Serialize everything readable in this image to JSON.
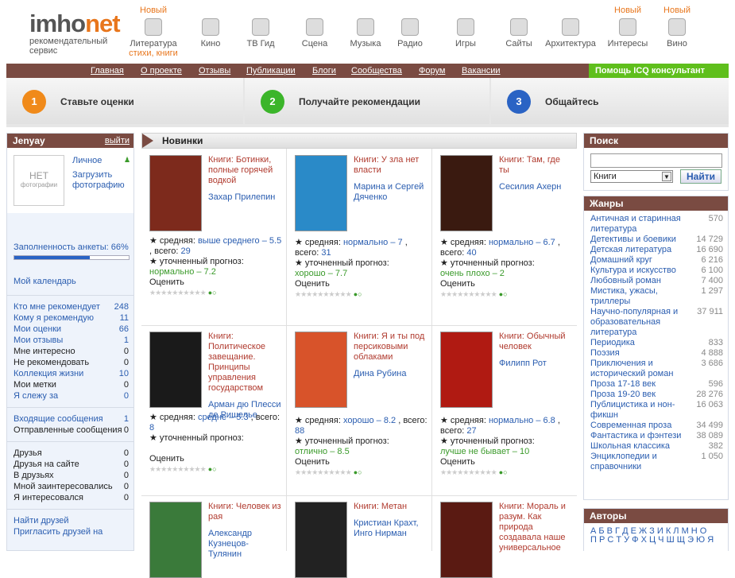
{
  "logo": {
    "im": "imho",
    "net": "net",
    "sub1": "рекомендательный",
    "sub2": "сервис"
  },
  "cats": [
    {
      "new": "Новый",
      "label": "Литература",
      "sub": "стихи, книги",
      "icon": "book-icon"
    },
    {
      "new": "",
      "label": "Кино",
      "sub": "",
      "icon": "film-reel-icon"
    },
    {
      "new": "",
      "label": "ТВ Гид",
      "sub": "",
      "icon": "tv-icon"
    },
    {
      "new": "",
      "label": "Сцена",
      "sub": "",
      "icon": "theater-mask-icon"
    },
    {
      "new": "",
      "label": "Музыка",
      "sub": "",
      "icon": "headphones-icon"
    },
    {
      "new": "",
      "label": "Радио",
      "sub": "",
      "icon": "radio-icon"
    },
    {
      "new": "",
      "label": "Игры",
      "sub": "",
      "icon": "gamepad-icon"
    },
    {
      "new": "",
      "label": "Сайты",
      "sub": "",
      "icon": "globe-icon"
    },
    {
      "new": "",
      "label": "Архитектура",
      "sub": "",
      "icon": "building-icon"
    },
    {
      "new": "Новый",
      "label": "Интересы",
      "sub": "",
      "icon": "helicopter-icon"
    },
    {
      "new": "Новый",
      "label": "Вино",
      "sub": "",
      "icon": "wine-glass-icon"
    }
  ],
  "nav": [
    "Главная",
    "О проекте",
    "Отзывы",
    "Публикации",
    "Блоги",
    "Сообщества",
    "Форум",
    "Вакансии"
  ],
  "nav_right": "Помощь   ICQ консультант",
  "steps": [
    {
      "n": "1",
      "text": "Ставьте оценки",
      "color": "#f08a1a"
    },
    {
      "n": "2",
      "text": "Получайте рекомендации",
      "color": "#3bb52a"
    },
    {
      "n": "3",
      "text": "Общайтесь",
      "color": "#2a63c4"
    }
  ],
  "user": {
    "name": "Jenyay",
    "logout": "выйти",
    "nophoto1": "НЕТ",
    "nophoto2": "фотографии",
    "personal": "Личное",
    "upload": "Загрузить фотографию",
    "fill": "Заполненность анкеты: 66%",
    "fill_pct": 0.66,
    "calendar": "Мой календарь"
  },
  "stats1": [
    [
      "Кто мне рекомендует",
      "248",
      1
    ],
    [
      "Кому я рекомендую",
      "11",
      1
    ],
    [
      "Мои оценки",
      "66",
      1
    ],
    [
      "Мои отзывы",
      "1",
      1
    ],
    [
      "Мне интересно",
      "0",
      0
    ],
    [
      "Не рекомендовать",
      "0",
      0
    ],
    [
      "Коллекция жизни",
      "10",
      1
    ],
    [
      "Мои метки",
      "0",
      0
    ],
    [
      "Я слежу за",
      "0",
      1
    ]
  ],
  "stats2": [
    [
      "Входящие сообщения",
      "1",
      1
    ],
    [
      "Отправленные сообщения",
      "0",
      0
    ]
  ],
  "stats3": [
    [
      "Друзья",
      "0",
      0
    ],
    [
      "Друзья на сайте",
      "0",
      0
    ],
    [
      "В друзьях",
      "0",
      0
    ],
    [
      "Мной заинтересовались",
      "0",
      0
    ],
    [
      "Я интересовался",
      "0",
      0
    ]
  ],
  "find": [
    "Найти друзей",
    "Пригласить друзей на"
  ],
  "center_title": "Новинки",
  "books": [
    {
      "title": "Книги: Ботинки, полные горячей водкой",
      "author": "Захар Прилепин",
      "l1": "★ средняя:",
      "l1v": "выше среднего – 5.5",
      "l1t": ", всего:",
      "cnt": "29",
      "l2": "★ уточненный прогноз:",
      "l2v": "нормально – 7.2",
      "rate": "Оценить",
      "cover": "#7d2a1c"
    },
    {
      "title": "Книги: У зла нет власти",
      "author": "Марина и Сергей Дяченко",
      "l1": "★ средняя:",
      "l1v": "нормально – 7",
      "l1t": ", всего:",
      "cnt": "31",
      "l2": "★ уточненный прогноз:",
      "l2v": "хорошо – 7.7",
      "rate": "Оценить",
      "cover": "#2a8ac8"
    },
    {
      "title": "Книги: Там, где ты",
      "author": "Сесилия Ахерн",
      "l1": "★ средняя:",
      "l1v": "нормально – 6.7",
      "l1t": ", всего:",
      "cnt": "40",
      "l2": "★ уточненный прогноз:",
      "l2v": "очень плохо – 2",
      "rate": "Оценить",
      "cover": "#3a1a10"
    },
    {
      "title": "Книги: Политическое завещание. Принципы управления государством",
      "author": "Арман дю Плесси де Ришелье",
      "l1": "★ средняя:",
      "l1v": "средне – 5.3",
      "l1t": ", всего:",
      "cnt": "8",
      "l2": "★ уточненный прогноз:",
      "l2v": "",
      "rate": "Оценить",
      "cover": "#1a1a1a"
    },
    {
      "title": "Книги: Я и ты под персиковыми облаками",
      "author": "Дина Рубина",
      "l1": "★ средняя:",
      "l1v": "хорошо – 8.2",
      "l1t": ", всего:",
      "cnt": "88",
      "l2": "★ уточненный прогноз:",
      "l2v": "отлично – 8.5",
      "rate": "Оценить",
      "cover": "#d8532a"
    },
    {
      "title": "Книги: Обычный человек",
      "author": "Филипп Рот",
      "l1": "★ средняя:",
      "l1v": "нормально – 6.8",
      "l1t": ", всего:",
      "cnt": "27",
      "l2": "★ уточненный прогноз:",
      "l2v": "лучше не бывает – 10",
      "rate": "Оценить",
      "cover": "#b01a12"
    },
    {
      "title": "Книги: Человек из рая",
      "author": "Александр Кузнецов-Тулянин",
      "cover": "#3a7a3a"
    },
    {
      "title": "Книги: Метан",
      "author": "Кристиан Крахт, Инго Нирман",
      "cover": "#222"
    },
    {
      "title": "Книги: Мораль и разум. Как природа создавала наше универсальное",
      "author": "",
      "cover": "#5a1a12"
    }
  ],
  "search": {
    "title": "Поиск",
    "select": "Книги",
    "button": "Найти"
  },
  "genres_title": "Жанры",
  "genres": [
    [
      "Античная и старинная литература",
      "570"
    ],
    [
      "Детективы и боевики",
      "14 729"
    ],
    [
      "Детская литература",
      "16 690"
    ],
    [
      "Домашний круг",
      "6 216"
    ],
    [
      "Культура и искусство",
      "6 100"
    ],
    [
      "Любовный роман",
      "7 400"
    ],
    [
      "Мистика, ужасы, триллеры",
      "1 297"
    ],
    [
      "Научно-популярная и образовательная литература",
      "37 911"
    ],
    [
      "Периодика",
      "833"
    ],
    [
      "Поэзия",
      "4 888"
    ],
    [
      "Приключения и исторический роман",
      "3 686"
    ],
    [
      "Проза 17-18 век",
      "596"
    ],
    [
      "Проза 19-20 век",
      "28 276"
    ],
    [
      "Публицистика и нон-фикшн",
      "16 063"
    ],
    [
      "Современная проза",
      "34 499"
    ],
    [
      "Фантастика и фэнтези",
      "38 089"
    ],
    [
      "Школьная классика",
      "382"
    ],
    [
      "Энциклопедии и справочники",
      "1 050"
    ]
  ],
  "authors_title": "Авторы",
  "alphabet1": "А Б В Г Д Е Ж З И К Л М Н О",
  "alphabet2": "П Р С Т У Ф Х Ц Ч Ш Щ Э Ю Я"
}
